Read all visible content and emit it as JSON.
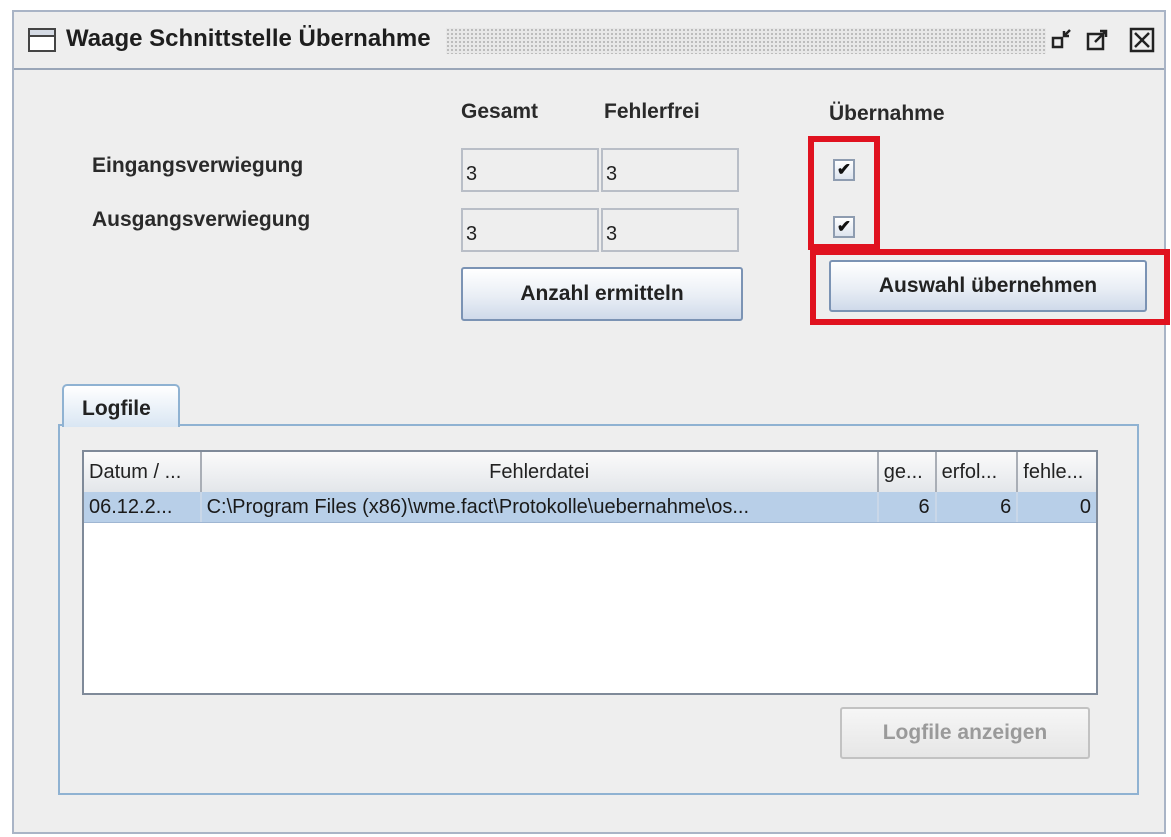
{
  "window": {
    "title": "Waage Schnittstelle Übernahme"
  },
  "headers": {
    "gesamt": "Gesamt",
    "fehlerfrei": "Fehlerfrei",
    "uebernahme": "Übernahme"
  },
  "rows": [
    {
      "label": "Eingangsverwiegung",
      "gesamt": "3",
      "fehlerfrei": "3",
      "uebernahme_checked": true
    },
    {
      "label": "Ausgangsverwiegung",
      "gesamt": "3",
      "fehlerfrei": "3",
      "uebernahme_checked": true
    }
  ],
  "buttons": {
    "anzahl_ermitteln": "Anzahl ermitteln",
    "auswahl_uebernehmen": "Auswahl übernehmen",
    "logfile_anzeigen": "Logfile anzeigen"
  },
  "checkbox_mark": "✔",
  "highlight_color": "#e0121f",
  "tab": {
    "label": "Logfile"
  },
  "log_table": {
    "columns": [
      "Datum / ...",
      "Fehlerdatei",
      "ge...",
      "erfol...",
      "fehle..."
    ],
    "rows": [
      [
        "06.12.2...",
        "C:\\Program Files (x86)\\wme.fact\\Protokolle\\uebernahme\\os...",
        "6",
        "6",
        "0"
      ]
    ]
  }
}
